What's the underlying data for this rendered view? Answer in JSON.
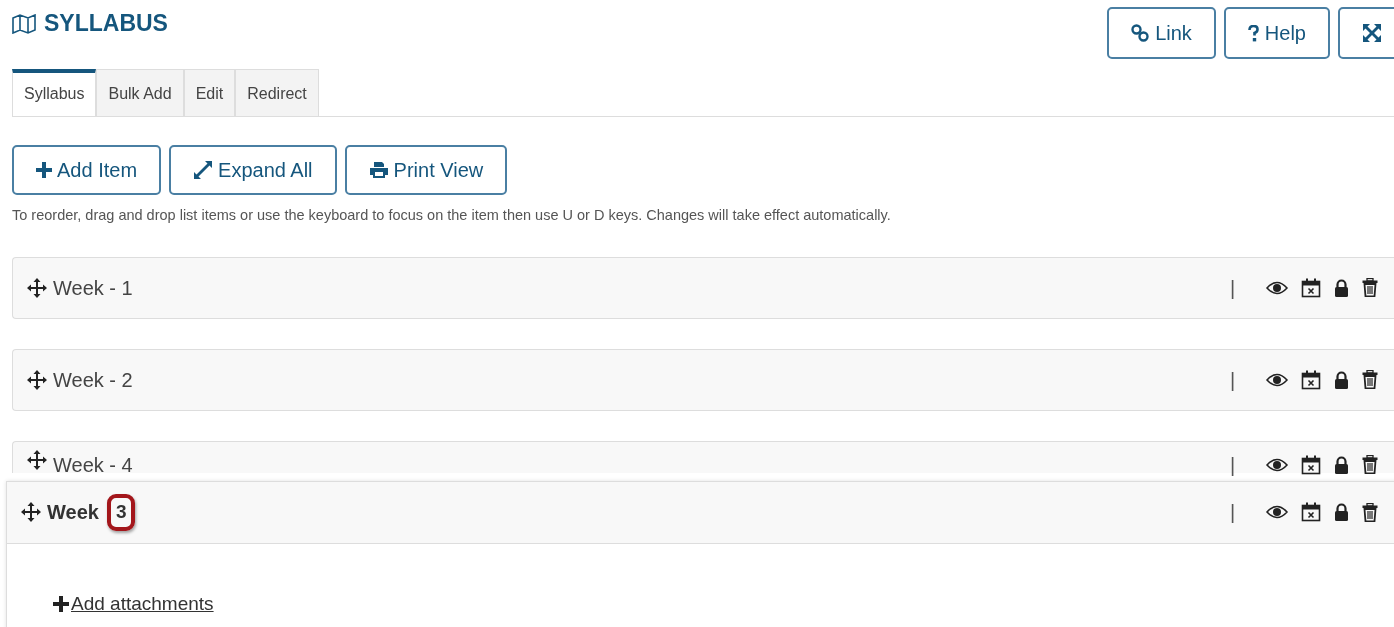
{
  "page": {
    "title": "SYLLABUS"
  },
  "header_buttons": [
    {
      "kind": "link",
      "label": "Link"
    },
    {
      "kind": "help",
      "label": "Help"
    },
    {
      "kind": "expand"
    }
  ],
  "tabs": [
    {
      "label": "Syllabus",
      "selected": true
    },
    {
      "label": "Bulk Add",
      "selected": false
    },
    {
      "label": "Edit",
      "selected": false
    },
    {
      "label": "Redirect",
      "selected": false
    }
  ],
  "toolbar": [
    {
      "kind": "add",
      "label": "Add Item"
    },
    {
      "kind": "expand",
      "label": "Expand All"
    },
    {
      "kind": "print",
      "label": "Print View"
    }
  ],
  "instructions": "To reorder, drag and drop list items or use the keyboard to focus on the item then use U or D keys. Changes will take effect automatically.",
  "items": [
    {
      "title": "Week - 1",
      "separator": "|"
    },
    {
      "title": "Week - 2",
      "separator": "|"
    },
    {
      "title": "Week - 4",
      "separator": "|"
    }
  ],
  "dragged_item": {
    "title": "Week",
    "number": "3",
    "highlighted": true,
    "separator": "|",
    "link": "Add attachments"
  }
}
